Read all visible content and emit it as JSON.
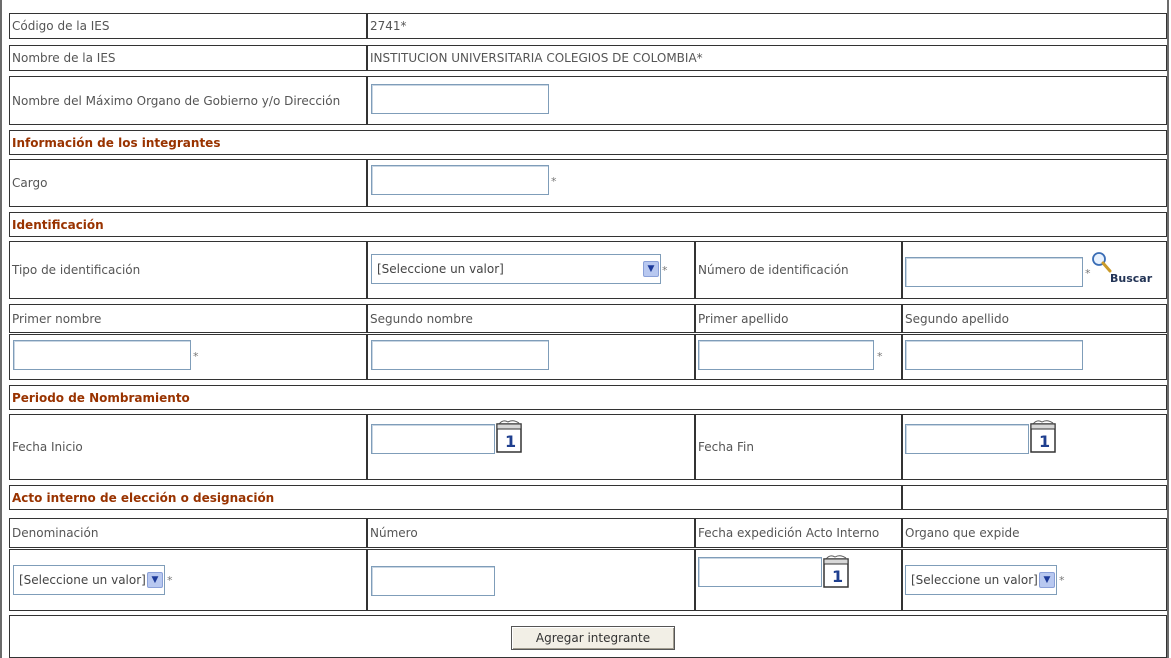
{
  "ies": {
    "codigo_label": "Código de la IES",
    "codigo_value": "2741*",
    "nombre_label": "Nombre de la IES",
    "nombre_value": "INSTITUCION UNIVERSITARIA COLEGIOS DE COLOMBIA*",
    "organo_label": "Nombre del Máximo Organo de Gobierno y/o Dirección"
  },
  "integrantes": {
    "section_title": "Información de los integrantes",
    "cargo_label": "Cargo"
  },
  "identificacion": {
    "section_title": "Identificación",
    "tipo_label": "Tipo de identificación",
    "tipo_value": "[Seleccione un valor]",
    "numero_label": "Número de identificación",
    "buscar_label": "Buscar",
    "primer_nombre": "Primer nombre",
    "segundo_nombre": "Segundo nombre",
    "primer_apellido": "Primer apellido",
    "segundo_apellido": "Segundo apellido"
  },
  "periodo": {
    "section_title": "Periodo de Nombramiento",
    "fecha_inicio_label": "Fecha Inicio",
    "fecha_fin_label": "Fecha Fin"
  },
  "acto": {
    "section_title": "Acto interno de elección o designación",
    "denominacion_label": "Denominación",
    "numero_label": "Número",
    "fecha_expedicion_label": "Fecha expedición Acto Interno",
    "organo_label": "Organo que expide",
    "denominacion_value": "[Seleccione un valor]",
    "organo_value": "[Seleccione un valor]"
  },
  "required_mark": "*",
  "calendar_day": "1",
  "agregar_button": "Agregar integrante"
}
